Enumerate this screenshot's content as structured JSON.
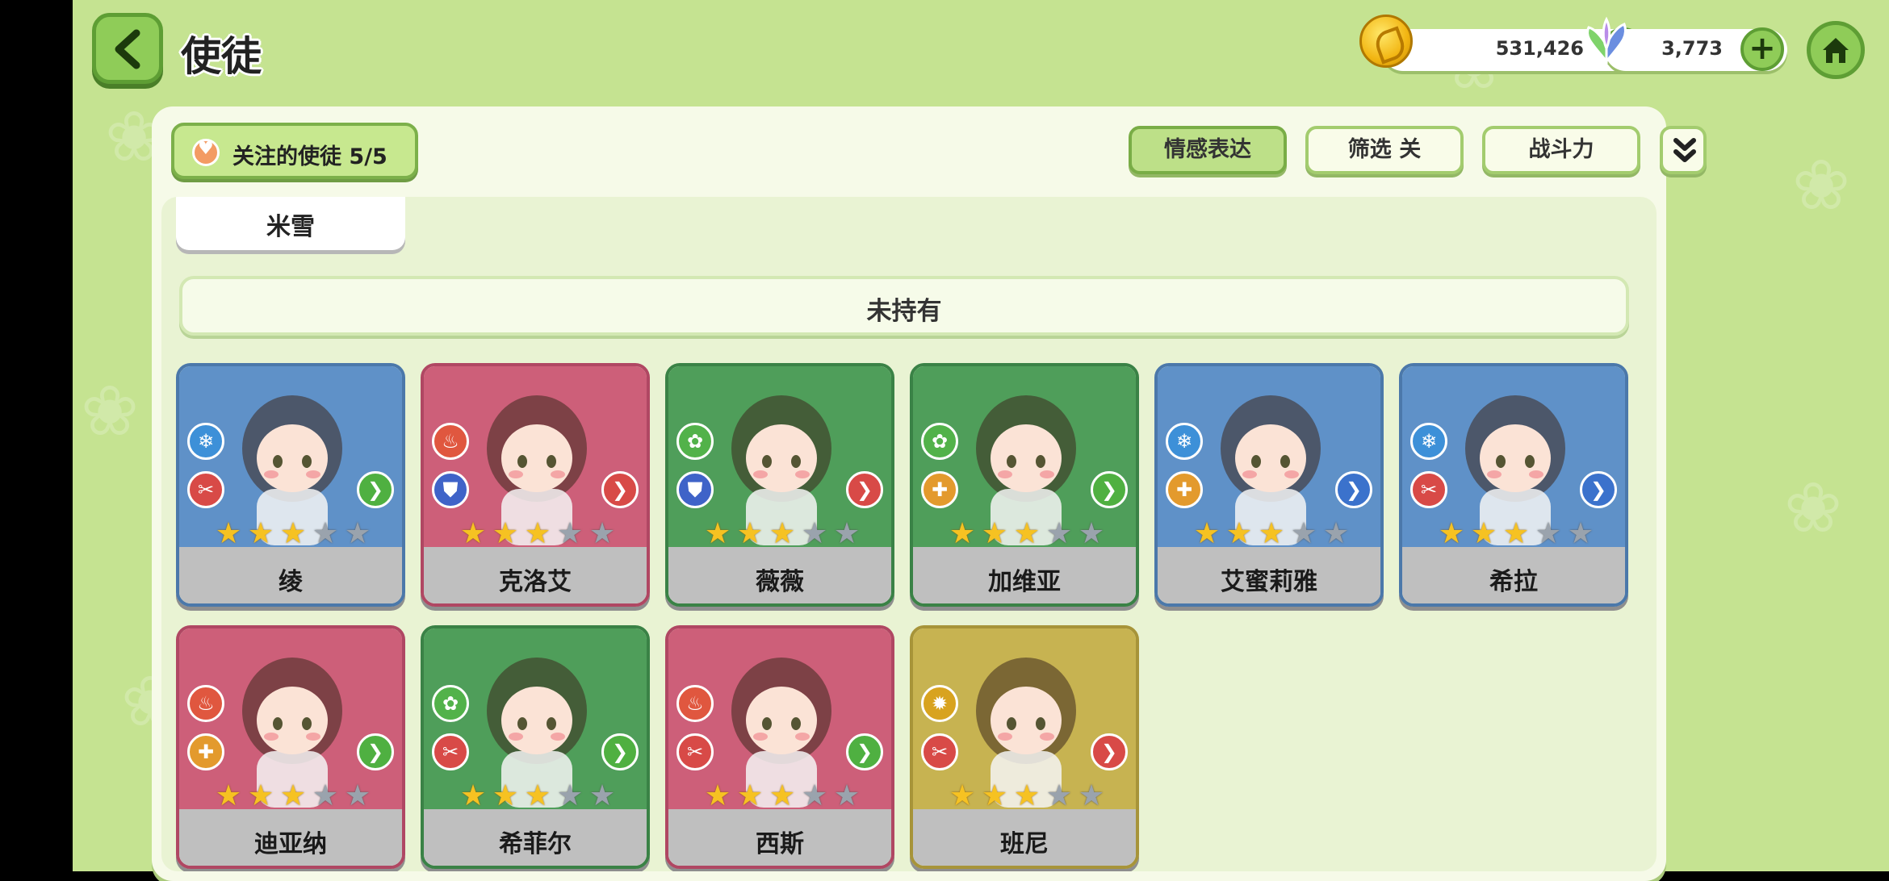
{
  "header": {
    "title": "使徒",
    "coins": "531,426",
    "gems": "3,773",
    "plus_label": "+"
  },
  "toolbar": {
    "followed_label": "关注的使徒",
    "followed_count": "5/5",
    "emotion_label": "情感表达",
    "filter_label": "筛选 关",
    "power_label": "战斗力"
  },
  "partial_card": {
    "name": "米雪"
  },
  "section": {
    "title": "未持有"
  },
  "characters": [
    {
      "name": "绫",
      "frame": "blue",
      "element": "ice",
      "role": "red",
      "arrow": "green",
      "stars": 3
    },
    {
      "name": "克洛艾",
      "frame": "pink",
      "element": "fire",
      "role": "blue",
      "arrow": "red",
      "stars": 3
    },
    {
      "name": "薇薇",
      "frame": "green",
      "element": "leaf",
      "role": "blue",
      "arrow": "red",
      "stars": 3
    },
    {
      "name": "加维亚",
      "frame": "green",
      "element": "leaf",
      "role": "orange",
      "arrow": "green",
      "stars": 3
    },
    {
      "name": "艾蜜莉雅",
      "frame": "blue",
      "element": "ice",
      "role": "orange",
      "arrow": "blue",
      "stars": 3
    },
    {
      "name": "希拉",
      "frame": "blue",
      "element": "ice",
      "role": "red",
      "arrow": "blue",
      "stars": 3
    },
    {
      "name": "迪亚纳",
      "frame": "pink",
      "element": "fire",
      "role": "orange",
      "arrow": "green",
      "stars": 3
    },
    {
      "name": "希菲尔",
      "frame": "green",
      "element": "leaf",
      "role": "red",
      "arrow": "green",
      "stars": 3
    },
    {
      "name": "西斯",
      "frame": "pink",
      "element": "fire",
      "role": "red",
      "arrow": "green",
      "stars": 3
    },
    {
      "name": "班尼",
      "frame": "olive",
      "element": "sun",
      "role": "red",
      "arrow": "red",
      "stars": 3
    }
  ],
  "colors": {
    "background": "#c5e391",
    "panel": "#f6fae8",
    "button_green": "#8fcc58",
    "star_on": "#f6c222",
    "star_off": "#9aa3ad"
  },
  "icons": [
    "back-arrow-icon",
    "coin-icon",
    "gem-icon",
    "home-icon",
    "heart-icon",
    "double-chevron-down-icon",
    "star-icon"
  ]
}
